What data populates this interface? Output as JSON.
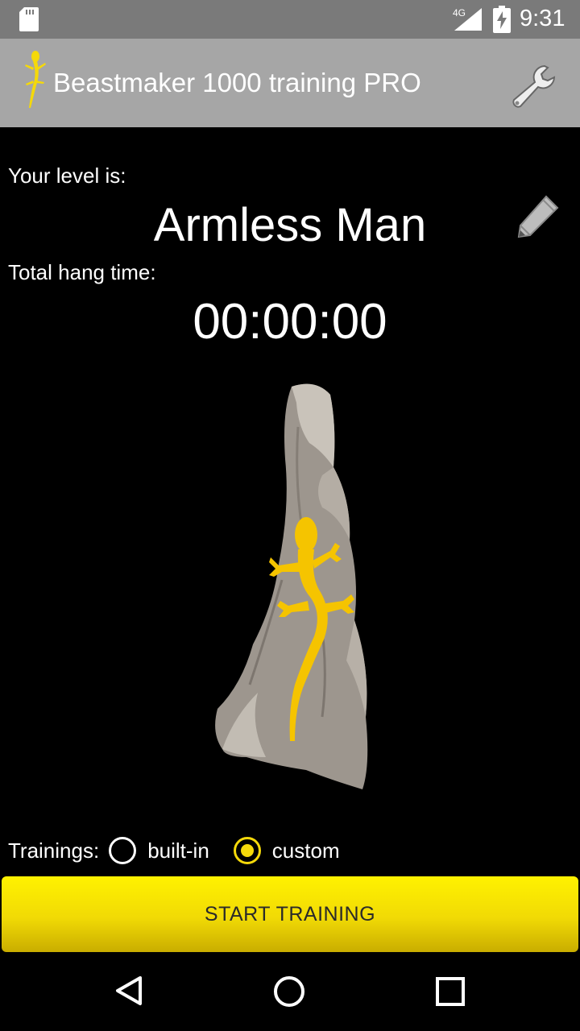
{
  "status_bar": {
    "network": "4G",
    "time": "9:31"
  },
  "toolbar": {
    "title": "Beastmaker 1000 training PRO",
    "settings_icon": "wrench-icon",
    "logo_icon": "lizard-icon"
  },
  "level": {
    "label": "Your level is:",
    "name": "Armless Man",
    "edit_icon": "pencil-icon"
  },
  "hang": {
    "label": "Total hang time:",
    "time": "00:00:00"
  },
  "trainings": {
    "label": "Trainings:",
    "options": [
      {
        "label": "built-in",
        "selected": false
      },
      {
        "label": "custom",
        "selected": true
      }
    ]
  },
  "start_button": {
    "label": "START TRAINING"
  },
  "colors": {
    "accent": "#f5d90a",
    "toolbar": "#a6a6a6",
    "status_bar": "#7a7a7a"
  }
}
